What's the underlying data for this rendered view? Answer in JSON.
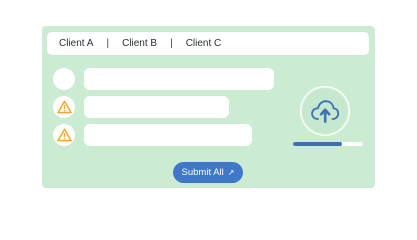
{
  "tabs": [
    {
      "label": "Client A"
    },
    {
      "label": "Client B"
    },
    {
      "label": "Client C"
    }
  ],
  "separator": "|",
  "rows": [
    {
      "icon": "empty-circle"
    },
    {
      "icon": "warning-icon"
    },
    {
      "icon": "warning-icon"
    }
  ],
  "upload": {
    "icon": "cloud-upload-icon",
    "progress": 0.7
  },
  "submit": {
    "label": "Submit All",
    "icon": "external-arrow-icon",
    "arrow": "↗"
  },
  "colors": {
    "panel": "#cbebd2",
    "accent": "#3f78c9",
    "progress": "#3f6fb5",
    "warning": "#f2a533"
  }
}
